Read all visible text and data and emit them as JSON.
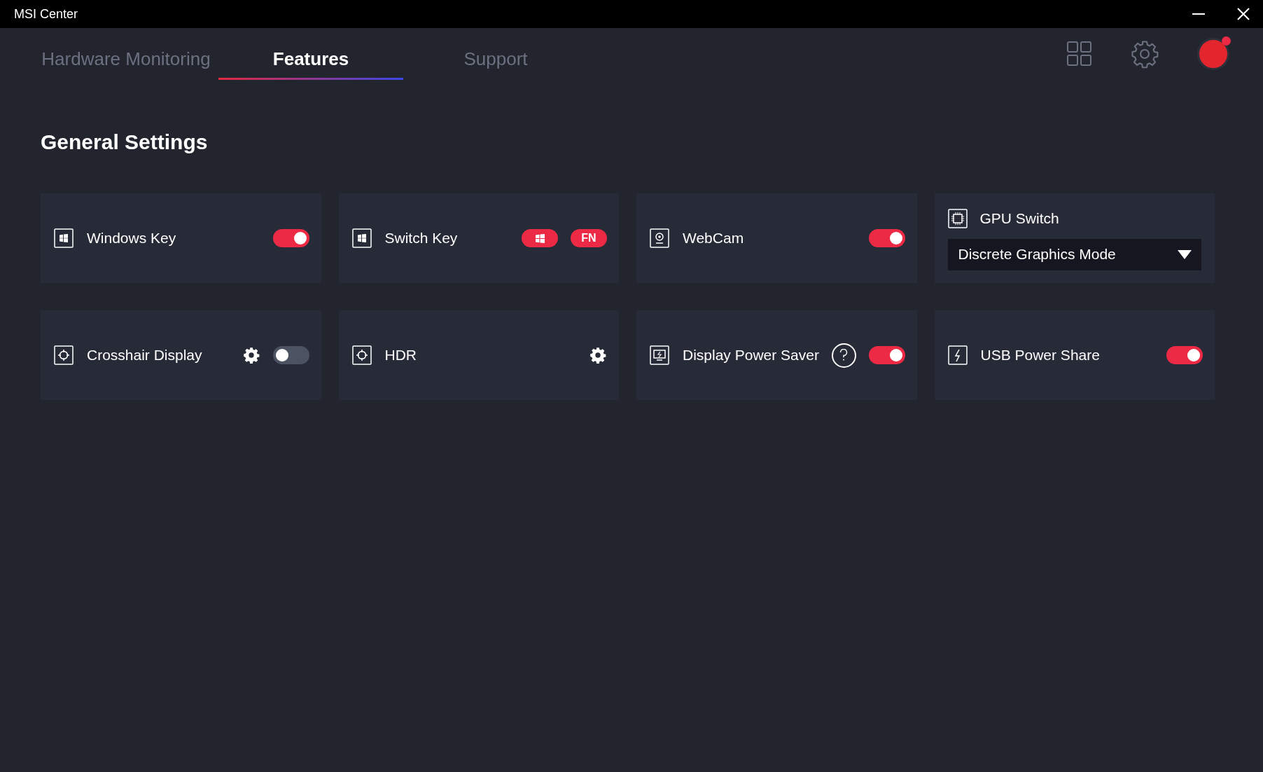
{
  "window": {
    "title": "MSI Center"
  },
  "tabs": [
    {
      "label": "Hardware Monitoring",
      "selected": false
    },
    {
      "label": "Features",
      "selected": true
    },
    {
      "label": "Support",
      "selected": false
    }
  ],
  "avatar": {
    "badge": true
  },
  "heading": "General Settings",
  "cards": [
    {
      "kind": "row",
      "label": "Windows Key",
      "controls": [
        {
          "kind": "toggle",
          "on": true
        }
      ]
    },
    {
      "kind": "row",
      "label": "Switch Key",
      "controls": [
        {
          "kind": "key-icon"
        },
        {
          "kind": "key-text",
          "label": "FN"
        }
      ]
    },
    {
      "kind": "row",
      "label": "WebCam",
      "controls": [
        {
          "kind": "toggle",
          "on": true
        }
      ]
    },
    {
      "kind": "dropdown",
      "label": "GPU Switch",
      "value": "Discrete Graphics Mode"
    },
    {
      "kind": "row",
      "label": "Crosshair Display",
      "controls": [
        {
          "kind": "gear"
        },
        {
          "kind": "toggle",
          "on": false
        }
      ]
    },
    {
      "kind": "row",
      "label": "HDR",
      "controls": [
        {
          "kind": "gear"
        }
      ]
    },
    {
      "kind": "row",
      "label": "Display Power Saver",
      "controls": [
        {
          "kind": "help"
        },
        {
          "kind": "toggle",
          "on": true
        }
      ]
    },
    {
      "kind": "row",
      "label": "USB Power Share",
      "controls": [
        {
          "kind": "toggle",
          "on": true
        }
      ]
    }
  ]
}
